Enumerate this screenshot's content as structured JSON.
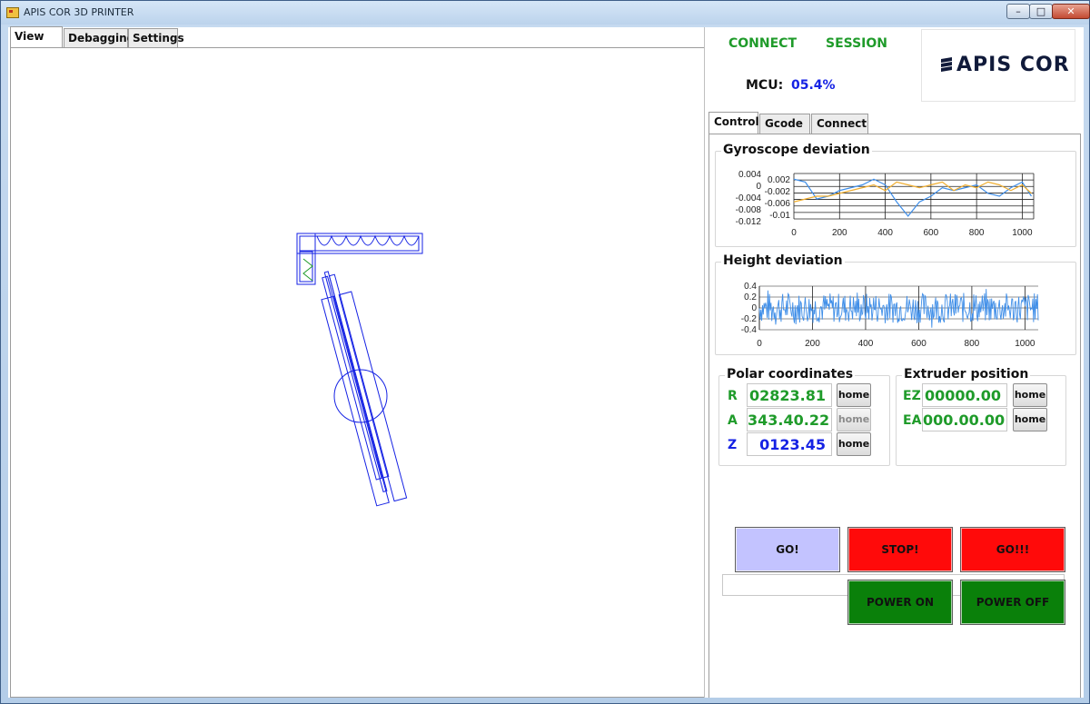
{
  "window": {
    "title": "APIS COR 3D PRINTER",
    "controls": [
      "–",
      "□",
      "✕"
    ]
  },
  "left_tabs": [
    {
      "label": "View",
      "active": true
    },
    {
      "label": "Debagging",
      "active": false
    },
    {
      "label": "Settings",
      "active": false
    }
  ],
  "header": {
    "connect_label": "CONNECT",
    "session_label": "SESSION",
    "mcu_label": "MCU:",
    "mcu_value": "05.4%",
    "logo_text": "APIS COR"
  },
  "right_tabs": [
    {
      "label": "Control",
      "active": true
    },
    {
      "label": "Gcode",
      "active": false
    },
    {
      "label": "Connect",
      "active": false
    }
  ],
  "gyroscope": {
    "title": "Gyroscope deviation",
    "chart_data": {
      "type": "line",
      "title": "Gyroscope deviation",
      "xlabel": "",
      "ylabel": "",
      "xlim": [
        0,
        1050
      ],
      "x_ticks": [
        "0",
        "200",
        "400",
        "600",
        "800",
        "1000"
      ],
      "y_ticks_outer": [
        "0.004",
        "0",
        "-0.004",
        "-0.008",
        "-0.012"
      ],
      "y_ticks_inner": [
        "0.002",
        "-0.002",
        "-0.006",
        "-0.01"
      ],
      "ylim": [
        -0.012,
        0.004
      ],
      "grid": true,
      "series": [
        {
          "color": "#3f8ee8",
          "x": [
            0,
            50,
            100,
            150,
            200,
            250,
            300,
            350,
            400,
            450,
            500,
            550,
            600,
            650,
            700,
            750,
            800,
            850,
            900,
            950,
            1000,
            1040
          ],
          "y": [
            0.002,
            0.001,
            -0.005,
            -0.004,
            -0.002,
            -0.001,
            0.0,
            0.002,
            0.0,
            -0.006,
            -0.011,
            -0.006,
            -0.004,
            -0.001,
            -0.002,
            -0.001,
            0.0,
            -0.003,
            -0.004,
            -0.001,
            0.001,
            -0.004
          ]
        },
        {
          "color": "#f0ae30",
          "x": [
            0,
            50,
            100,
            150,
            200,
            250,
            300,
            350,
            400,
            450,
            500,
            550,
            600,
            650,
            700,
            750,
            800,
            850,
            900,
            950,
            1000,
            1040
          ],
          "y": [
            -0.006,
            -0.005,
            -0.004,
            -0.004,
            -0.003,
            -0.002,
            -0.001,
            0.0,
            -0.002,
            0.001,
            0.0,
            -0.001,
            0.0,
            0.001,
            -0.002,
            0.0,
            -0.001,
            0.001,
            0.0,
            -0.002,
            0.0,
            -0.003
          ]
        }
      ]
    }
  },
  "height": {
    "title": "Height deviation",
    "chart_data": {
      "type": "line",
      "title": "Height deviation",
      "xlabel": "",
      "ylabel": "",
      "xlim": [
        0,
        1050
      ],
      "ylim": [
        -0.4,
        0.4
      ],
      "x_ticks": [
        "0",
        "200",
        "400",
        "600",
        "800",
        "1000"
      ],
      "y_ticks": [
        "0.4",
        "0.2",
        "0",
        "-0.2",
        "-0.4"
      ],
      "grid": true,
      "series": [
        {
          "color": "#3f8ee8",
          "kind": "noise",
          "amplitude": 0.28,
          "points": 360
        }
      ]
    }
  },
  "polar": {
    "title": "Polar coordinates",
    "rows": [
      {
        "label": "R",
        "value": "02823.81",
        "color": "#1f9b2a",
        "button": "home",
        "enabled": true
      },
      {
        "label": "A",
        "value": "343.40.22",
        "color": "#1f9b2a",
        "button": "home",
        "enabled": false
      },
      {
        "label": "Z",
        "value": "0123.45",
        "color": "#1522e4",
        "button": "home",
        "enabled": true
      }
    ]
  },
  "extruder": {
    "title": "Extruder position",
    "rows": [
      {
        "label": "EZ",
        "value": "00000.00",
        "color": "#1f9b2a",
        "button": "home"
      },
      {
        "label": "EA",
        "value": "000.00.00",
        "color": "#1f9b2a",
        "button": "home"
      }
    ]
  },
  "actions": {
    "go": "GO!",
    "stop": "STOP!",
    "go_force": "GO!!!",
    "power_on": "POWER ON",
    "power_off": "POWER OFF"
  },
  "colors": {
    "go": "#c3c3ff",
    "stop": "#ff0a0a",
    "power": "#0a800a",
    "drawing": "#1522e4",
    "accent_green": "#1f9b2a"
  }
}
